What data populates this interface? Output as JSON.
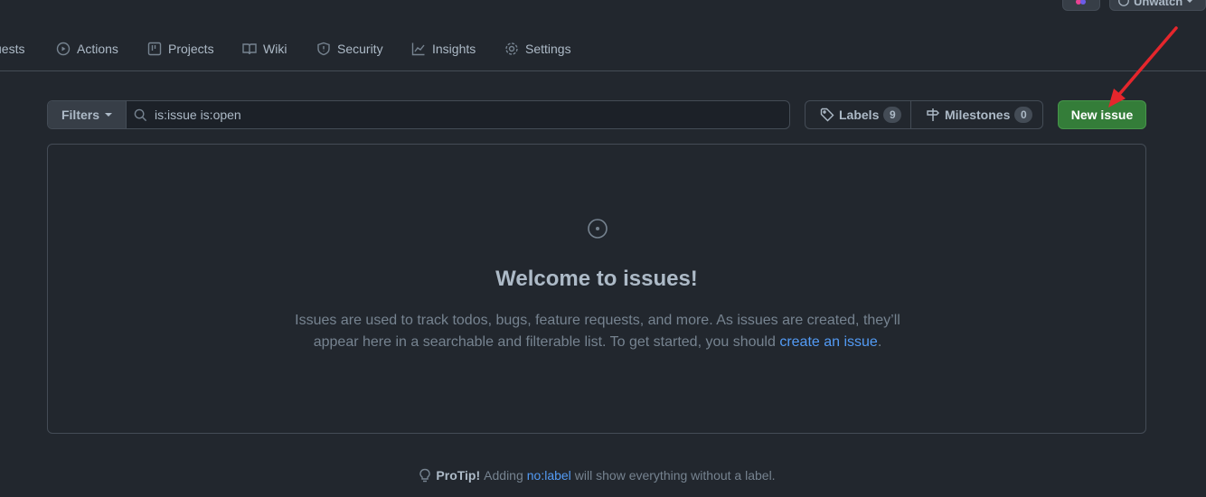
{
  "top_controls": {
    "watch_label": "Unwatch"
  },
  "repo_nav": {
    "items": [
      {
        "label": "uests",
        "icon": "pull-request-icon"
      },
      {
        "label": "Actions",
        "icon": "play-icon"
      },
      {
        "label": "Projects",
        "icon": "table-icon"
      },
      {
        "label": "Wiki",
        "icon": "book-icon"
      },
      {
        "label": "Security",
        "icon": "shield-icon"
      },
      {
        "label": "Insights",
        "icon": "graph-icon"
      },
      {
        "label": "Settings",
        "icon": "gear-icon"
      }
    ]
  },
  "filter_bar": {
    "filters_label": "Filters",
    "search_value": "is:issue is:open",
    "labels_label": "Labels",
    "labels_count": "9",
    "milestones_label": "Milestones",
    "milestones_count": "0",
    "new_issue_label": "New issue"
  },
  "blankslate": {
    "title": "Welcome to issues!",
    "description": "Issues are used to track todos, bugs, feature requests, and more. As issues are created, they’ll appear here in a searchable and filterable list. To get started, you should ",
    "link_text": "create an issue",
    "trailing": "."
  },
  "protip": {
    "title": "ProTip!",
    "pre": "Adding",
    "link": "no:label",
    "post": "will show everything without a label."
  },
  "colors": {
    "background": "#22272e",
    "border": "#444c56",
    "primary_button": "#347d39",
    "link": "#539bf5",
    "annotation_arrow": "#e5262c"
  }
}
